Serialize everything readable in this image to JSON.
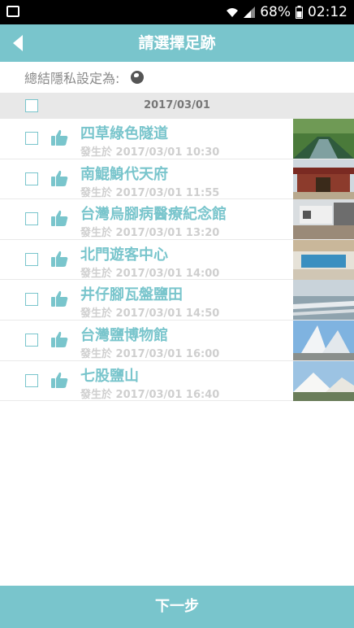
{
  "status": {
    "battery": "68%",
    "time": "02:12"
  },
  "header": {
    "title": "請選擇足跡"
  },
  "privacy": {
    "label": "總結隱私設定為:"
  },
  "group": {
    "date": "2017/03/01"
  },
  "items": [
    {
      "name": "四草綠色隧道",
      "time": "發生於 2017/03/01  10:30"
    },
    {
      "name": "南鯤鯓代天府",
      "time": "發生於 2017/03/01  11:55"
    },
    {
      "name": "台灣烏腳病醫療紀念館",
      "time": "發生於 2017/03/01  13:20"
    },
    {
      "name": "北門遊客中心",
      "time": "發生於 2017/03/01  14:00"
    },
    {
      "name": "井仔腳瓦盤鹽田",
      "time": "發生於 2017/03/01  14:50"
    },
    {
      "name": "台灣鹽博物館",
      "time": "發生於 2017/03/01  16:00"
    },
    {
      "name": "七股鹽山",
      "time": "發生於 2017/03/01  16:40"
    }
  ],
  "footer": {
    "next_label": "下一步"
  },
  "colors": {
    "accent": "#79c5cc",
    "divider": "#e9e9e9",
    "date_bar": "#e8e8e8"
  }
}
